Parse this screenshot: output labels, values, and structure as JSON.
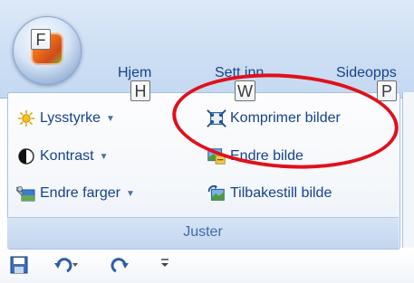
{
  "office_button": {
    "keytip": "F"
  },
  "tabs": [
    {
      "label": "Hjem",
      "keytip": "H"
    },
    {
      "label": "Sett inn",
      "keytip": "W"
    },
    {
      "label": "Sideopps",
      "keytip": "P"
    }
  ],
  "group": {
    "label": "Juster",
    "commands": [
      {
        "label": "Lysstyrke",
        "icon": "sun-icon",
        "has_dropdown": true
      },
      {
        "label": "Kontrast",
        "icon": "contrast-icon",
        "has_dropdown": true
      },
      {
        "label": "Endre farger",
        "icon": "recolor-icon",
        "has_dropdown": true
      },
      {
        "label": "Komprimer bilder",
        "icon": "compress-pictures-icon",
        "has_dropdown": false
      },
      {
        "label": "Endre bilde",
        "icon": "change-picture-icon",
        "has_dropdown": false
      },
      {
        "label": "Tilbakestill bilde",
        "icon": "reset-picture-icon",
        "has_dropdown": false
      }
    ]
  },
  "annotation": {
    "color": "#e0101a"
  },
  "quick_access": {
    "items": [
      "save-icon",
      "undo-icon",
      "redo-icon",
      "customize-icon"
    ]
  },
  "colors": {
    "label_text": "#15428b",
    "group_label": "#3e6aaa",
    "ribbon_bg": "#cddff4"
  }
}
